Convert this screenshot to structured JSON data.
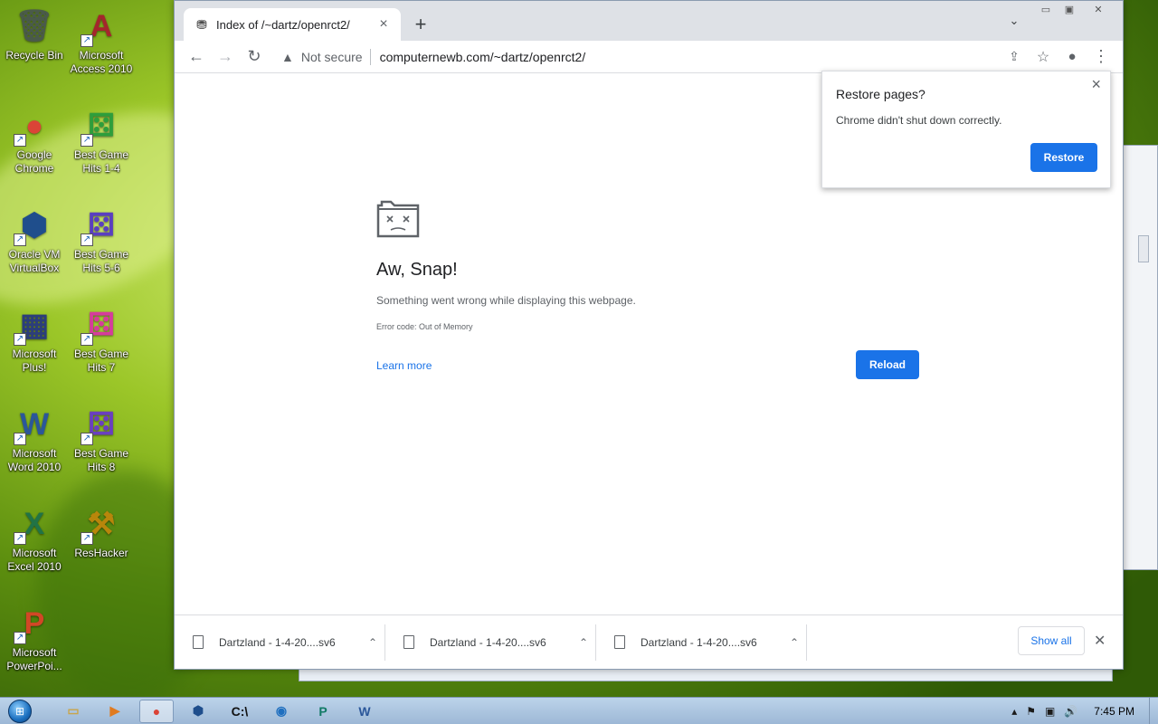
{
  "desktop": {
    "icons": [
      {
        "label": "Recycle Bin",
        "glyph": "🗑",
        "color": "#4a5a4a"
      },
      {
        "label": "Microsoft\nAccess 2010",
        "glyph": "A",
        "color": "#a4262c"
      },
      {
        "label": "Google\nChrome",
        "glyph": "●",
        "color": "#db4437"
      },
      {
        "label": "Best Game\nHits 1-4",
        "glyph": "⚄",
        "color": "#2e9e3c"
      },
      {
        "label": "Oracle VM\nVirtualBox",
        "glyph": "⬢",
        "color": "#1f4e8c"
      },
      {
        "label": "Best Game\nHits 5-6",
        "glyph": "⚄",
        "color": "#5a3fc0"
      },
      {
        "label": "Microsoft\nPlus!",
        "glyph": "▦",
        "color": "#2c3e7a"
      },
      {
        "label": "Best Game\nHits 7",
        "glyph": "⚄",
        "color": "#d63c9c"
      },
      {
        "label": "Microsoft\nWord 2010",
        "glyph": "W",
        "color": "#2b579a"
      },
      {
        "label": "Best Game\nHits 8",
        "glyph": "⚄",
        "color": "#6a3fc0"
      },
      {
        "label": "Microsoft\nExcel 2010",
        "glyph": "X",
        "color": "#217346"
      },
      {
        "label": "ResHacker",
        "glyph": "⚒",
        "color": "#b8860b"
      },
      {
        "label": "Microsoft\nPowerPoi...",
        "glyph": "P",
        "color": "#d24726"
      }
    ]
  },
  "browser": {
    "tab_title": "Index of /~dartz/openrct2/",
    "security_label": "Not secure",
    "url": "computernewb.com/~dartz/openrct2/",
    "error": {
      "title": "Aw, Snap!",
      "message": "Something went wrong while displaying this webpage.",
      "code": "Error code: Out of Memory",
      "learn_more": "Learn more",
      "reload": "Reload"
    },
    "restore_popup": {
      "title": "Restore pages?",
      "message": "Chrome didn't shut down correctly.",
      "button": "Restore"
    },
    "downloads": [
      {
        "name": "Dartzland - 1-4-20....sv6"
      },
      {
        "name": "Dartzland - 1-4-20....sv6"
      },
      {
        "name": "Dartzland - 1-4-20....sv6"
      }
    ],
    "show_all": "Show all",
    "accent": "#1a73e8"
  },
  "taskbar": {
    "apps": [
      {
        "name": "windows-explorer",
        "glyph": "▭",
        "color": "#c9a54a"
      },
      {
        "name": "media-player",
        "glyph": "▶",
        "color": "#e07a1f"
      },
      {
        "name": "chrome",
        "glyph": "●",
        "color": "#db4437",
        "active": true
      },
      {
        "name": "virtualbox",
        "glyph": "⬢",
        "color": "#1f4e8c"
      },
      {
        "name": "command-prompt",
        "glyph": "C:\\",
        "color": "#111"
      },
      {
        "name": "globe",
        "glyph": "◉",
        "color": "#1f6fbf"
      },
      {
        "name": "publisher",
        "glyph": "P",
        "color": "#117a65"
      },
      {
        "name": "word",
        "glyph": "W",
        "color": "#2b579a"
      }
    ],
    "clock": "7:45 PM"
  }
}
